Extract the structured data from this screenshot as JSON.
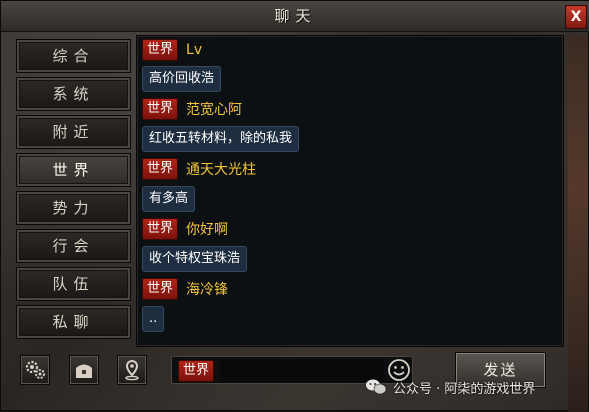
{
  "window": {
    "title": "聊天",
    "close_label": "X"
  },
  "sidebar": {
    "tabs": [
      {
        "label": "综合"
      },
      {
        "label": "系统"
      },
      {
        "label": "附近"
      },
      {
        "label": "世界",
        "active": true
      },
      {
        "label": "势力"
      },
      {
        "label": "行会"
      },
      {
        "label": "队伍"
      },
      {
        "label": "私聊"
      }
    ]
  },
  "chat": {
    "messages": [
      {
        "channel": "世界",
        "sender": "Lv",
        "text": "高价回收浩"
      },
      {
        "channel": "世界",
        "sender": "范宽心阿",
        "text": "红收五转材料，除的私我"
      },
      {
        "channel": "世界",
        "sender": "通天大光柱",
        "text": "有多高"
      },
      {
        "channel": "世界",
        "sender": "你好啊",
        "text": "收个特权宝珠浩"
      },
      {
        "channel": "世界",
        "sender": "海冷锋",
        "text": ".."
      }
    ]
  },
  "toolbar": {
    "settings_icon": "gear-icon",
    "chest_icon": "chest-icon",
    "location_icon": "location-pin-icon",
    "channel_label": "世界",
    "input_value": "",
    "emoji_icon": "smiley-icon",
    "send_label": "发送"
  },
  "watermark": {
    "text": "公众号 · 阿柒的游戏世界"
  },
  "colors": {
    "channel_tag": "#b02418",
    "sender_name": "#f2c43c",
    "bubble_bg": "#1e2e40"
  }
}
